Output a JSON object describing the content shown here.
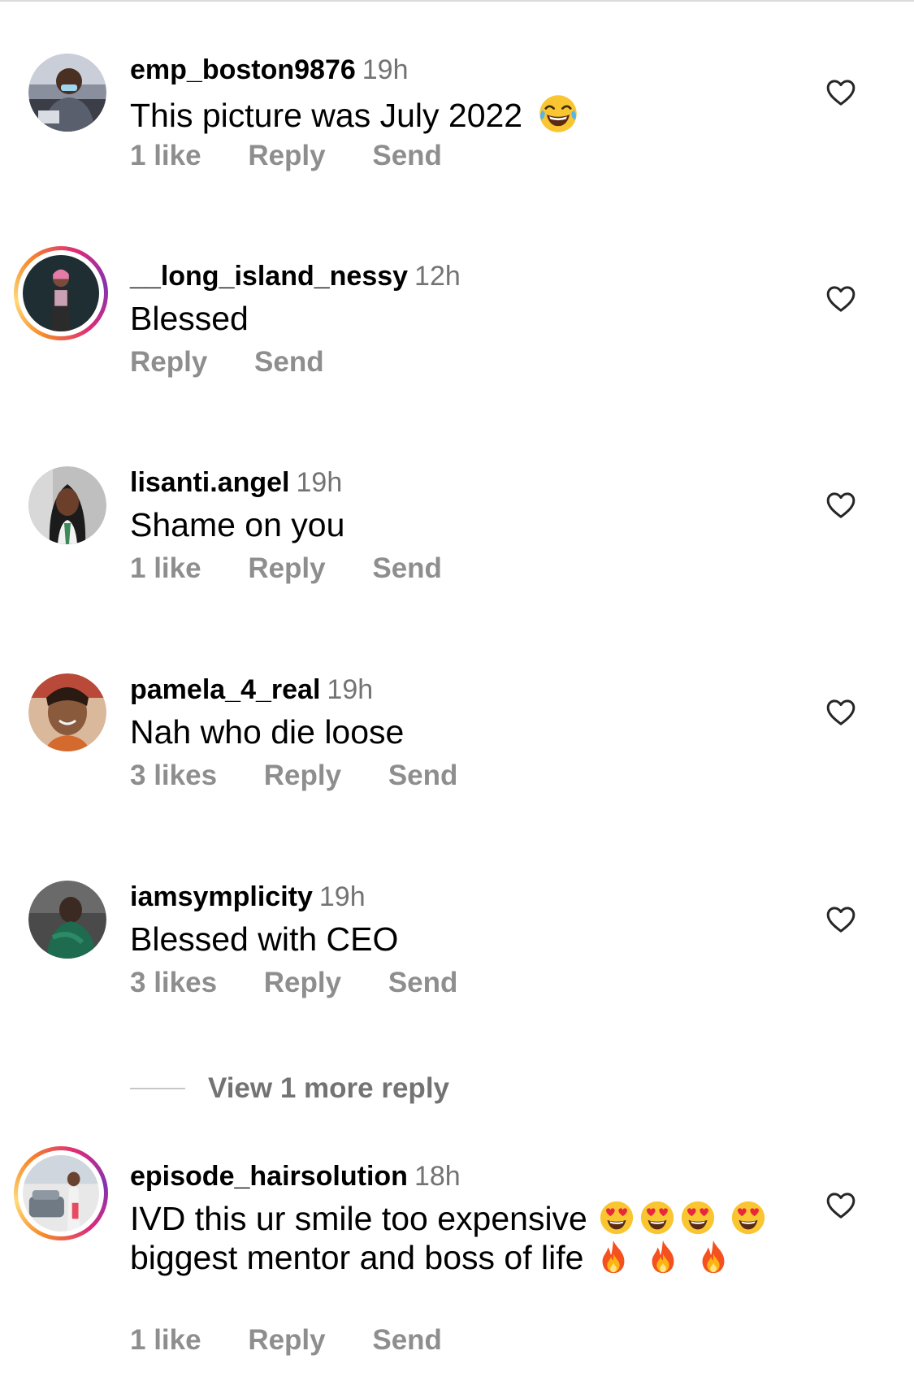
{
  "comments": [
    {
      "username": "emp_boston9876",
      "time": "19h",
      "text": "This picture was July 2022",
      "likes": "1 like",
      "reply": "Reply",
      "send": "Send",
      "emoji": "laughing-tears-emoji"
    },
    {
      "username": "__long_island_nessy",
      "time": "12h",
      "text": "Blessed",
      "likes": "",
      "reply": "Reply",
      "send": "Send"
    },
    {
      "username": "lisanti.angel",
      "time": "19h",
      "text": "Shame on you",
      "likes": "1 like",
      "reply": "Reply",
      "send": "Send"
    },
    {
      "username": "pamela_4_real",
      "time": "19h",
      "text": "Nah who die loose",
      "likes": "3 likes",
      "reply": "Reply",
      "send": "Send"
    },
    {
      "username": "iamsymplicity",
      "time": "19h",
      "text": "Blessed with CEO",
      "likes": "3 likes",
      "reply": "Reply",
      "send": "Send"
    },
    {
      "username": "episode_hairsolution",
      "time": "18h",
      "text_part1": "IVD this ur smile too expensive",
      "text_part2": "biggest mentor and boss of life",
      "likes": "1 like",
      "reply": "Reply",
      "send": "Send"
    }
  ],
  "view_more_replies": "View 1 more reply",
  "icons": {
    "heart": "heart-outline-icon",
    "laugh": "face-with-tears-of-joy-emoji",
    "heart_eyes": "heart-eyes-emoji",
    "fire": "fire-emoji"
  },
  "colors": {
    "text": "#000000",
    "secondary": "#8e8e8e",
    "time": "#737373",
    "story_ring": "#dd2a7b"
  }
}
